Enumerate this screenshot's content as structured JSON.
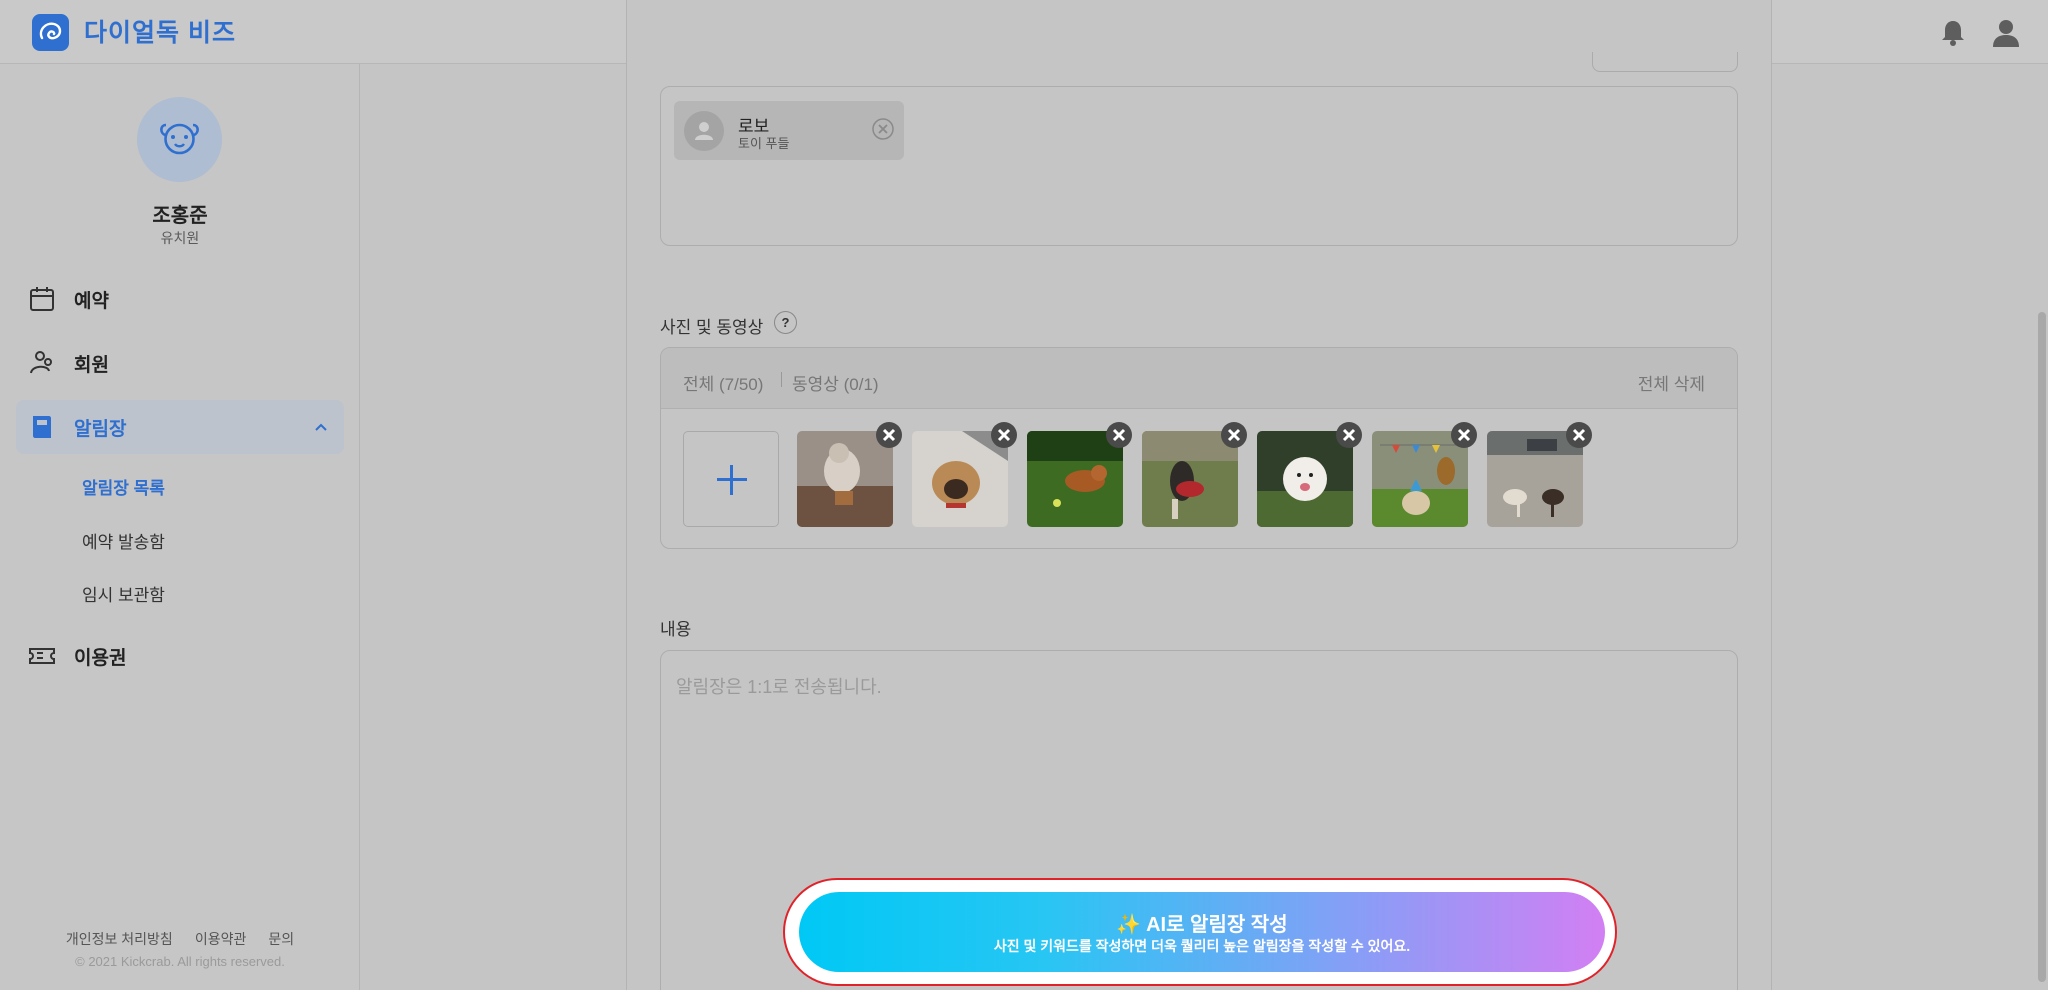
{
  "brand": {
    "name": "다이얼독 비즈",
    "accent": "#2f6fcf"
  },
  "header": {
    "icons": [
      "bell-icon",
      "user-icon"
    ]
  },
  "profile": {
    "name": "조홍준",
    "role": "유치원"
  },
  "sidebar": {
    "items": [
      {
        "label": "예약",
        "icon": "calendar-icon"
      },
      {
        "label": "회원",
        "icon": "member-icon"
      },
      {
        "label": "알림장",
        "icon": "notebook-icon",
        "active": true
      },
      {
        "label": "이용권",
        "icon": "ticket-icon"
      }
    ],
    "subitems": [
      {
        "label": "알림장 목록",
        "active": true
      },
      {
        "label": "예약 발송함"
      },
      {
        "label": "임시 보관함"
      }
    ],
    "footer_links": [
      "개인정보 처리방침",
      "이용약관",
      "문의"
    ],
    "copyright": "© 2021 Kickcrab. All rights reserved."
  },
  "recipients": {
    "chip": {
      "name": "로보",
      "breed": "토이 푸들"
    }
  },
  "media": {
    "title": "사진 및 동영상",
    "help": "?",
    "count_all": "전체 (7/50)",
    "count_video": "동영상 (0/1)",
    "delete_all": "전체 삭제",
    "thumbnails": [
      "dog-photo-1",
      "dog-photo-2",
      "dog-photo-3",
      "dog-photo-4",
      "dog-photo-5",
      "dog-photo-6",
      "dog-photo-7"
    ]
  },
  "content": {
    "label": "내용",
    "placeholder": "알림장은 1:1로 전송됩니다."
  },
  "ai_button": {
    "title": "✨ AI로 알림장 작성",
    "subtitle": "사진 및 키워드를 작성하면 더욱 퀄리티 높은 알림장을 작성할 수 있어요."
  }
}
